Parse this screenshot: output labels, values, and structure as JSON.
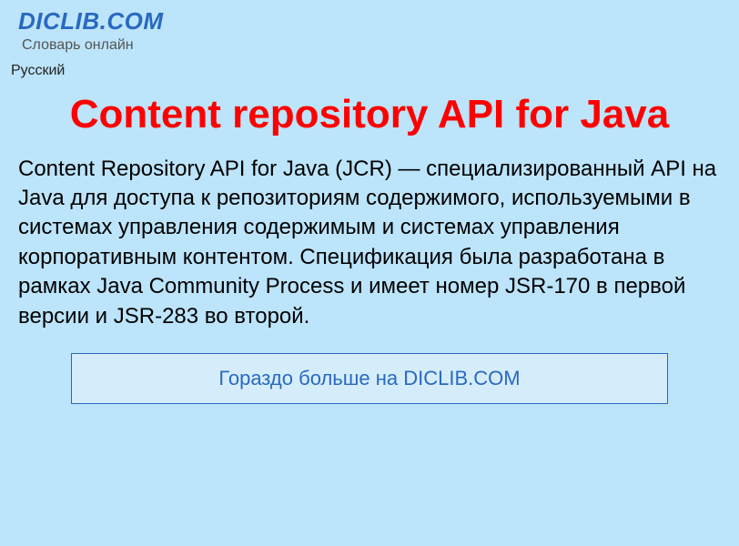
{
  "header": {
    "site_title": "DICLIB.COM",
    "tagline": "Словарь онлайн"
  },
  "lang": {
    "label": "Русский"
  },
  "article": {
    "title": "Content repository API for Java",
    "body": "Content Repository API for Java (JCR) — специализированный API на Java для доступа к репозиториям содержимого, используемыми в системах управления содержимым и системах управления корпоративным контентом. Спецификация была разработана в рамках Java Community Process и имеет номер JSR-170 в первой версии и JSR-283 во второй."
  },
  "more": {
    "label": "Гораздо больше на DICLIB.COM"
  }
}
